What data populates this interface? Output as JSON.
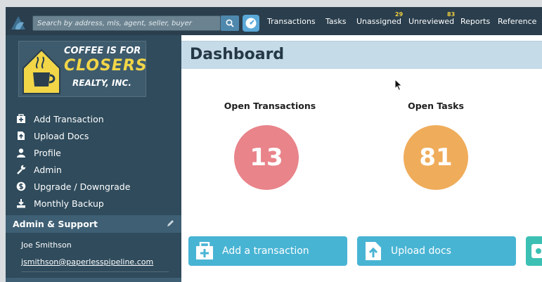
{
  "topbar": {
    "search_placeholder": "Search by address, mls, agent, seller, buyer",
    "nav": [
      {
        "label": "Transactions",
        "badge": ""
      },
      {
        "label": "Tasks",
        "badge": ""
      },
      {
        "label": "Unassigned",
        "badge": "29"
      },
      {
        "label": "Unreviewed",
        "badge": "83"
      },
      {
        "label": "Reports",
        "badge": ""
      },
      {
        "label": "Reference",
        "badge": ""
      }
    ]
  },
  "brand": {
    "line1": "COFFEE IS FOR",
    "line2": "CLOSERS",
    "line3": "REALTY, INC."
  },
  "sidebar": {
    "menu": [
      {
        "label": "Add Transaction",
        "icon": "briefcase-plus-icon"
      },
      {
        "label": "Upload Docs",
        "icon": "upload-docs-icon"
      },
      {
        "label": "Profile",
        "icon": "user-icon"
      },
      {
        "label": "Admin",
        "icon": "wrench-icon"
      },
      {
        "label": "Upgrade / Downgrade",
        "icon": "dollar-icon"
      },
      {
        "label": "Monthly Backup",
        "icon": "download-icon"
      }
    ],
    "section_title": "Admin & Support",
    "user_name": "Joe Smithson",
    "user_email": "jsmithson@paperlesspipeline.com"
  },
  "main": {
    "title": "Dashboard",
    "stats": [
      {
        "label": "Open Transactions",
        "value": "13",
        "color": "#e8848a"
      },
      {
        "label": "Open Tasks",
        "value": "81",
        "color": "#efac5a"
      }
    ],
    "actions": [
      {
        "label": "Add a transaction"
      },
      {
        "label": "Upload docs"
      }
    ]
  },
  "colors": {
    "sidebar_bg": "#2f4b5c",
    "header_bg": "#c5dbe8",
    "action_bg": "#48b4d4",
    "badge": "#f2d23c"
  }
}
